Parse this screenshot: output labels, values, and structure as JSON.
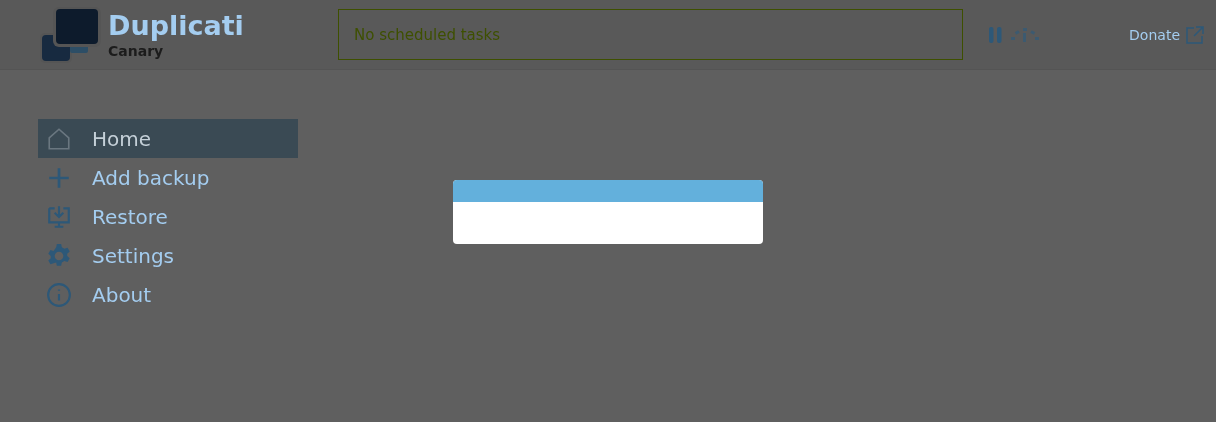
{
  "header": {
    "app_name": "Duplicati",
    "channel": "Canary",
    "status": "No scheduled tasks",
    "paused": true,
    "donate": "Donate"
  },
  "sidebar": {
    "items": [
      {
        "label": "Home",
        "selected": true
      },
      {
        "label": "Add backup",
        "selected": false
      },
      {
        "label": "Restore",
        "selected": false
      },
      {
        "label": "Settings",
        "selected": false
      },
      {
        "label": "About",
        "selected": false
      }
    ]
  },
  "dialog": {
    "kind": "loading"
  }
}
